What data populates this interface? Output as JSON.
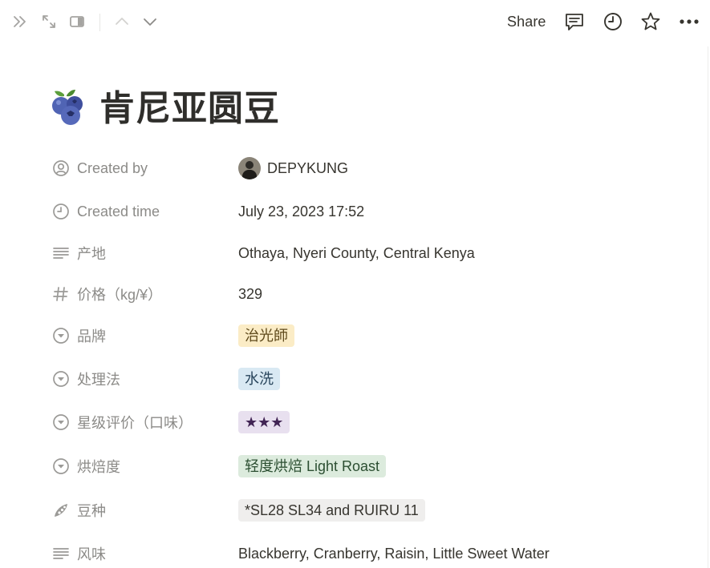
{
  "topbar": {
    "share_label": "Share",
    "icons": [
      "double-chevron-right-icon",
      "expand-arrows-icon",
      "side-panel-icon",
      "chevron-up-icon",
      "chevron-down-icon",
      "comment-icon",
      "clock-icon",
      "star-icon",
      "more-dots-icon"
    ]
  },
  "page": {
    "icon": "blueberry-icon",
    "title": "肯尼亚圆豆"
  },
  "properties": [
    {
      "label": "Created by",
      "icon": "person-circle-icon",
      "value": "DEPYKUNG"
    },
    {
      "label": "Created time",
      "icon": "clock-icon",
      "value": "July 23, 2023 17:52"
    },
    {
      "label": "产地",
      "icon": "text-lines-icon",
      "value": "Othaya, Nyeri County, Central Kenya"
    },
    {
      "label": "价格（kg/¥）",
      "icon": "hash-icon",
      "value": "329"
    },
    {
      "label": "品牌",
      "icon": "select-icon",
      "value": "治光師",
      "tag_bg": "#fbecc6",
      "tag_fg": "#5f4a1c"
    },
    {
      "label": "处理法",
      "icon": "select-icon",
      "value": "水洗",
      "tag_bg": "#d9e9f3",
      "tag_fg": "#28455c"
    },
    {
      "label": "星级评价（口味）",
      "icon": "select-icon",
      "value": "★★★",
      "tag_bg": "#e8e0ef",
      "tag_fg": "#412454"
    },
    {
      "label": "烘焙度",
      "icon": "select-icon",
      "value": "轻度烘焙 Light Roast",
      "tag_bg": "#dcebdd",
      "tag_fg": "#2c4f32"
    },
    {
      "label": "豆种",
      "icon": "bean-pod-icon",
      "value": "*SL28 SL34 and RUIRU 11",
      "tag_bg": "#efeeed",
      "tag_fg": "#37352f"
    },
    {
      "label": "风味",
      "icon": "text-lines-icon",
      "value": "Blackberry, Cranberry, Raisin, Little Sweet Water"
    }
  ]
}
